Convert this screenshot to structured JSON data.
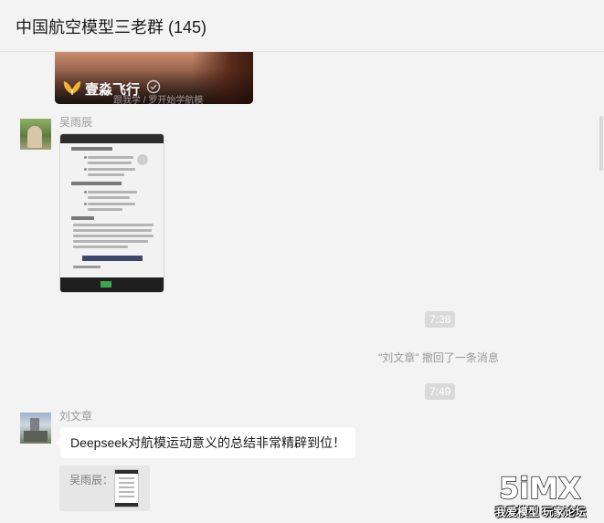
{
  "header": {
    "title": "中国航空模型三老群 (145)"
  },
  "video_card": {
    "brand": "壹淼飞行",
    "caption": "跟我学 / 罗开始学航模",
    "brand_icon": "butterfly-logo-icon",
    "verify_icon": "verified-check-icon"
  },
  "messages": [
    {
      "sender": "吴雨辰",
      "type": "image"
    },
    {
      "timestamp": "7:38"
    },
    {
      "system": "\"刘文章\" 撤回了一条消息"
    },
    {
      "timestamp": "7:49"
    },
    {
      "sender": "刘文章",
      "type": "text",
      "text": "Deepseek对航模运动意义的总结非常精辟到位！",
      "quote": {
        "author": "吴雨辰："
      }
    }
  ],
  "watermark": {
    "logo_text": "5iMX",
    "tagline": "我爱模型 玩家论坛"
  }
}
